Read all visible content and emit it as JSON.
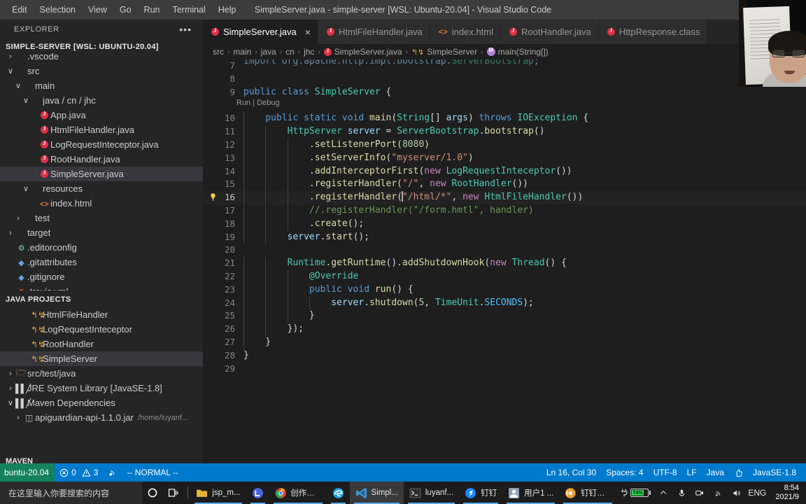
{
  "titlebar": {
    "window_title": "SimpleServer.java - simple-server [WSL: Ubuntu-20.04] - Visual Studio Code",
    "menus": [
      "Edit",
      "Selection",
      "View",
      "Go",
      "Run",
      "Terminal",
      "Help"
    ]
  },
  "sidebar": {
    "title": "EXPLORER",
    "more_actions": "•••",
    "explorer_root": "SIMPLE-SERVER [WSL: UBUNTU-20.04]",
    "tree": [
      {
        "label": ".vscode",
        "indent": 0,
        "twisty": "›",
        "icon": "",
        "selected": false
      },
      {
        "label": "src",
        "indent": 0,
        "twisty": "∨",
        "icon": "",
        "selected": false
      },
      {
        "label": "main",
        "indent": 1,
        "twisty": "∨",
        "icon": "",
        "selected": false
      },
      {
        "label": "java / cn / jhc",
        "indent": 2,
        "twisty": "∨",
        "icon": "",
        "selected": false
      },
      {
        "label": "App.java",
        "indent": 3,
        "twisty": "",
        "icon": "java-file-icon",
        "selected": false
      },
      {
        "label": "HtmlFileHandler.java",
        "indent": 3,
        "twisty": "",
        "icon": "java-file-icon",
        "selected": false
      },
      {
        "label": "LogRequestInteceptor.java",
        "indent": 3,
        "twisty": "",
        "icon": "java-file-icon",
        "selected": false
      },
      {
        "label": "RootHandler.java",
        "indent": 3,
        "twisty": "",
        "icon": "java-file-icon",
        "selected": false
      },
      {
        "label": "SimpleServer.java",
        "indent": 3,
        "twisty": "",
        "icon": "java-file-icon",
        "selected": true
      },
      {
        "label": "resources",
        "indent": 2,
        "twisty": "∨",
        "icon": "",
        "selected": false
      },
      {
        "label": "index.html",
        "indent": 3,
        "twisty": "",
        "icon": "html-file-icon",
        "selected": false
      },
      {
        "label": "test",
        "indent": 1,
        "twisty": "›",
        "icon": "",
        "selected": false
      },
      {
        "label": "target",
        "indent": 0,
        "twisty": "›",
        "icon": "",
        "selected": false
      },
      {
        "label": ".editorconfig",
        "indent": 0,
        "twisty": "",
        "icon": "gear-icon",
        "selected": false
      },
      {
        "label": ".gitattributes",
        "indent": 0,
        "twisty": "",
        "icon": "git-icon",
        "selected": false
      },
      {
        "label": ".gitignore",
        "indent": 0,
        "twisty": "",
        "icon": "git-icon",
        "selected": false
      },
      {
        "label": ".travis.yml",
        "indent": 0,
        "twisty": "",
        "icon": "yaml-icon",
        "selected": false
      }
    ],
    "java_projects": {
      "title": "JAVA PROJECTS",
      "items": [
        {
          "label": "HtmlFileHandler",
          "indent": 2,
          "twisty": "",
          "icon": "class-icon",
          "selected": false,
          "sub": ""
        },
        {
          "label": "LogRequestInteceptor",
          "indent": 2,
          "twisty": "",
          "icon": "class-icon",
          "selected": false,
          "sub": ""
        },
        {
          "label": "RootHandler",
          "indent": 2,
          "twisty": "",
          "icon": "class-icon",
          "selected": false,
          "sub": ""
        },
        {
          "label": "SimpleServer",
          "indent": 2,
          "twisty": "",
          "icon": "class-icon",
          "selected": true,
          "sub": ""
        },
        {
          "label": "src/test/java",
          "indent": 0,
          "twisty": "›",
          "icon": "folder-icon",
          "selected": false,
          "sub": ""
        },
        {
          "label": "JRE System Library [JavaSE-1.8]",
          "indent": 0,
          "twisty": "›",
          "icon": "library-icon",
          "selected": false,
          "sub": ""
        },
        {
          "label": "Maven Dependencies",
          "indent": 0,
          "twisty": "∨",
          "icon": "library-icon",
          "selected": false,
          "sub": ""
        },
        {
          "label": "apiguardian-api-1.1.0.jar",
          "indent": 1,
          "twisty": "›",
          "icon": "jar-icon",
          "selected": false,
          "sub": "/home/luyanf..."
        }
      ]
    },
    "maven_section": "MAVEN"
  },
  "editor": {
    "tabs": [
      {
        "label": "SimpleServer.java",
        "icon": "java-file-icon",
        "active": true,
        "close": "×"
      },
      {
        "label": "HtmlFileHandler.java",
        "icon": "java-file-icon",
        "active": false,
        "close": ""
      },
      {
        "label": "index.html",
        "icon": "html-file-icon",
        "active": false,
        "close": ""
      },
      {
        "label": "RootHandler.java",
        "icon": "java-file-icon",
        "active": false,
        "close": ""
      },
      {
        "label": "HttpResponse.class",
        "icon": "java-file-icon",
        "active": false,
        "close": ""
      }
    ],
    "breadcrumb": [
      {
        "label": "src",
        "icon": ""
      },
      {
        "label": "main",
        "icon": ""
      },
      {
        "label": "java",
        "icon": ""
      },
      {
        "label": "cn",
        "icon": ""
      },
      {
        "label": "jhc",
        "icon": ""
      },
      {
        "label": "SimpleServer.java",
        "icon": "java-file-icon"
      },
      {
        "label": "SimpleServer",
        "icon": "class-icon"
      },
      {
        "label": "main(String[])",
        "icon": "method-icon"
      }
    ],
    "breadcrumb_separator": "›",
    "codelens": "Run | Debug",
    "lightbulb": "💡",
    "lines": [
      {
        "n": "7",
        "clipped": true
      },
      {
        "n": "8",
        "clipped": false
      },
      {
        "n": "9",
        "clipped": false
      },
      {
        "n": "10",
        "clipped": false
      },
      {
        "n": "11",
        "clipped": false
      },
      {
        "n": "12",
        "clipped": false
      },
      {
        "n": "13",
        "clipped": false
      },
      {
        "n": "14",
        "clipped": false
      },
      {
        "n": "15",
        "clipped": false
      },
      {
        "n": "16",
        "clipped": false
      },
      {
        "n": "17",
        "clipped": false
      },
      {
        "n": "18",
        "clipped": false
      },
      {
        "n": "19",
        "clipped": false
      },
      {
        "n": "20",
        "clipped": false
      },
      {
        "n": "21",
        "clipped": false
      },
      {
        "n": "22",
        "clipped": false
      },
      {
        "n": "23",
        "clipped": false
      },
      {
        "n": "24",
        "clipped": false
      },
      {
        "n": "25",
        "clipped": false
      },
      {
        "n": "26",
        "clipped": false
      },
      {
        "n": "27",
        "clipped": false
      },
      {
        "n": "28",
        "clipped": false
      },
      {
        "n": "29",
        "clipped": false
      }
    ],
    "source_text": [
      "import org.apache.http.impl.bootstrap.ServerBootstrap;",
      "",
      "public class SimpleServer {",
      "    public static void main(String[] args) throws IOException {",
      "        HttpServer server = ServerBootstrap.bootstrap()",
      "            .setListenerPort(8080)",
      "            .setServerInfo(\"myserver/1.0\")",
      "            .addInterceptorFirst(new LogRequestInteceptor())",
      "            .registerHandler(\"/\", new RootHandler())",
      "            .registerHandler(\"/html/*\", new HtmlFileHandler())",
      "            //.registerHandler(\"/form.hmtl\", handler)",
      "            .create();",
      "        server.start();",
      "",
      "        Runtime.getRuntime().addShutdownHook(new Thread() {",
      "            @Override",
      "            public void run() {",
      "                server.shutdown(5, TimeUnit.SECONDS);",
      "            }",
      "        });",
      "    }",
      "}",
      ""
    ]
  },
  "statusbar": {
    "remote": "buntu-20.04",
    "errors_icon": "error-icon",
    "errors": "0",
    "warnings_icon": "warning-icon",
    "warnings": "3",
    "radio_icon": "broadcast-icon",
    "vim_mode": "-- NORMAL --",
    "position": "Ln 16, Col 30",
    "indent": "Spaces: 4",
    "encoding": "UTF-8",
    "eol": "LF",
    "language": "Java",
    "feedback_icon": "thumbs-up-icon",
    "jdk": "JavaSE-1.8"
  },
  "taskbar": {
    "search_placeholder": "在这里输入你要搜索的内容",
    "cortana_icon": "circle-icon",
    "taskview_icon": "task-view-icon",
    "apps": [
      {
        "name": "jsp_m...",
        "icon": "folder-icon",
        "color": "#e8b339",
        "running": true,
        "active": false
      },
      {
        "name": "",
        "icon": "loop-icon",
        "color": "#4a63d8",
        "running": true,
        "active": false
      },
      {
        "name": "创作中...",
        "icon": "chrome-icon",
        "color": "#4caf50",
        "running": true,
        "active": false
      },
      {
        "name": "",
        "icon": "edge-icon",
        "color": "#1ba1e2",
        "running": true,
        "active": false
      },
      {
        "name": "Simpl...",
        "icon": "vscode-icon",
        "color": "#3c99d4",
        "running": true,
        "active": true
      },
      {
        "name": "luyanf...",
        "icon": "terminal-icon",
        "color": "#3a3a3a",
        "running": true,
        "active": false
      },
      {
        "name": "钉钉",
        "icon": "dingtalk-icon",
        "color": "#1989fa",
        "running": true,
        "active": false
      },
      {
        "name": "用户1 ...",
        "icon": "user-icon",
        "color": "#7b8ea3",
        "running": true,
        "active": false
      },
      {
        "name": "钉钉直...",
        "icon": "dingtalk-live-icon",
        "color": "#f0a030",
        "running": true,
        "active": false
      }
    ],
    "tray": {
      "battery_percent": "74%",
      "chevron_icon": "chevron-up-icon",
      "mic_icon": "microphone-icon",
      "camera_icon": "camera-icon",
      "wifi_icon": "wifi-icon",
      "volume_icon": "volume-icon",
      "language": "ENG",
      "time": "8:54",
      "date": "2021/9"
    }
  },
  "webcam": {
    "label": "webcam-overlay"
  }
}
